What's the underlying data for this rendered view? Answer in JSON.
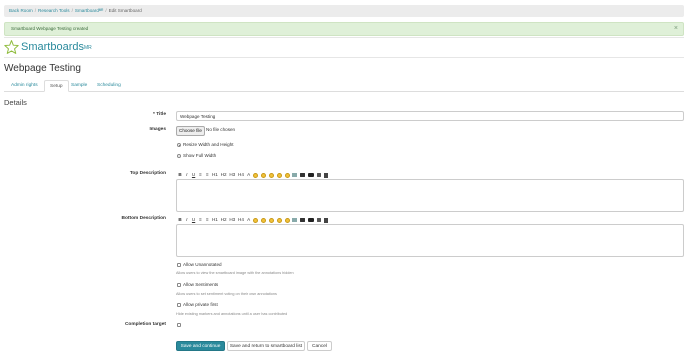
{
  "breadcrumb": {
    "items": [
      "Back Room",
      "Research Tools",
      "Smartboardᴹᴿ"
    ],
    "current": "Edit Smartboard",
    "separator": "/"
  },
  "alert": {
    "message": "Smartboard Webpage Testing created",
    "close": "×"
  },
  "logo": {
    "text": "Smartboards",
    "sup": "MR",
    "icon": "star-outline-icon"
  },
  "page_title": "Webpage Testing",
  "tabs": [
    {
      "label": "Admin rights",
      "active": false
    },
    {
      "label": "Setup",
      "active": true
    },
    {
      "label": "Sample",
      "active": false
    },
    {
      "label": "Scheduling",
      "active": false
    }
  ],
  "details_heading": "Details",
  "form": {
    "title_label": "* Title",
    "title_value": "Webpage Testing",
    "images_label": "Images",
    "file_button": "Choose file",
    "file_status": "No file chosen",
    "radio_resize": "Resize Width and Height",
    "radio_full": "Show Full Width",
    "top_desc_label": "Top Description",
    "bottom_desc_label": "Bottom Description",
    "toolbar_text": [
      "B",
      "I",
      "U",
      "≡",
      "≡",
      "H1",
      "H2",
      "H3",
      "H4",
      "A"
    ],
    "allow_unannotated": "Allow Unannotated",
    "allow_unannotated_hint": "Allow users to view the smartboard image with the annotations hidden",
    "allow_sentiments": "Allow Sentiments",
    "allow_sentiments_hint": "Allow users to set sentiment voting on their own annotations",
    "allow_private": "Allow private first",
    "allow_private_hint": "Hide existing markers and annotations until a user has contributed",
    "completion_label": "Completion target"
  },
  "buttons": {
    "save_continue": "Save and continue",
    "save_return": "Save and return to smartboard list",
    "cancel": "Cancel"
  },
  "colors": {
    "accent": "#2a8a9c",
    "alert_bg": "#dff0d8",
    "alert_text": "#3c6b3c"
  }
}
